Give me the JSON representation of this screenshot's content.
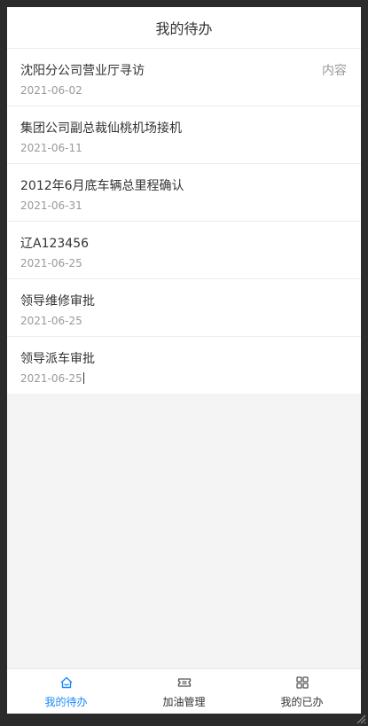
{
  "header": {
    "title": "我的待办"
  },
  "todo": {
    "items": [
      {
        "title": "沈阳分公司营业厅寻访",
        "date": "2021-06-02",
        "extra": "内容"
      },
      {
        "title": "集团公司副总裁仙桃机场接机",
        "date": "2021-06-11"
      },
      {
        "title": "2012年6月底车辆总里程确认",
        "date": "2021-06-31"
      },
      {
        "title": "辽A123456",
        "date": "2021-06-25"
      },
      {
        "title": "领导维修审批",
        "date": "2021-06-25"
      },
      {
        "title": "领导派车审批",
        "date": "2021-06-25"
      }
    ]
  },
  "tabbar": {
    "tabs": [
      {
        "label": "我的待办",
        "icon": "home-icon",
        "active": true
      },
      {
        "label": "加油管理",
        "icon": "ticket-icon",
        "active": false
      },
      {
        "label": "我的已办",
        "icon": "apps-grid-icon",
        "active": false
      }
    ]
  },
  "colors": {
    "accent": "#1989fa",
    "text": "#333333",
    "muted": "#999999",
    "background": "#f4f4f4"
  }
}
